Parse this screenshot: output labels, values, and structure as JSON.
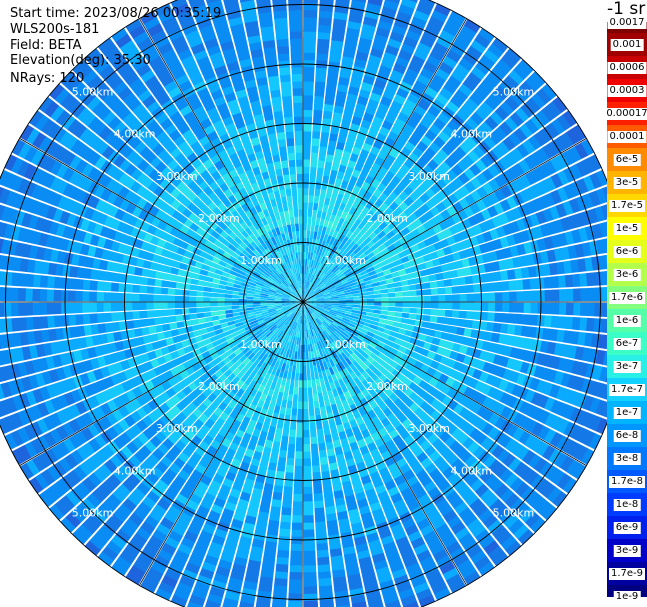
{
  "header": {
    "start_time": "Start time: 2023/08/26 00:35:19",
    "instrument": "WLS200s-181",
    "field": "Field: BETA",
    "elevation": "Elevation(deg): 35.30",
    "nrays": "NRays: 120"
  },
  "colorbar": {
    "unit": "-1 sr",
    "labels": [
      "0.0017",
      "0.001",
      "0.0006",
      "0.0003",
      "0.00017",
      "0.0001",
      "6e-5",
      "3e-5",
      "1.7e-5",
      "1e-5",
      "6e-6",
      "3e-6",
      "1.7e-6",
      "1e-6",
      "6e-7",
      "3e-7",
      "1.7e-7",
      "1e-7",
      "6e-8",
      "3e-8",
      "1.7e-8",
      "1e-8",
      "6e-9",
      "3e-9",
      "1.7e-9",
      "1e-9"
    ],
    "colors": [
      "#800000",
      "#a00000",
      "#c80000",
      "#f00000",
      "#ff2000",
      "#ff5a00",
      "#ff8c00",
      "#ffb400",
      "#ffd800",
      "#ffff00",
      "#e6ff1a",
      "#b4ff4b",
      "#82ff7d",
      "#55ffaa",
      "#3cffc8",
      "#28f0e6",
      "#14d2ff",
      "#00b4ff",
      "#0096ff",
      "#0078ff",
      "#005aff",
      "#003cff",
      "#0020ee",
      "#0000c8",
      "#0000a0",
      "#000080"
    ]
  },
  "ppi": {
    "ring_labels": [
      "1.00km",
      "2.00km",
      "3.00km",
      "4.00km",
      "5.00km"
    ],
    "rays": 120,
    "max_range_km": 5.5
  }
}
